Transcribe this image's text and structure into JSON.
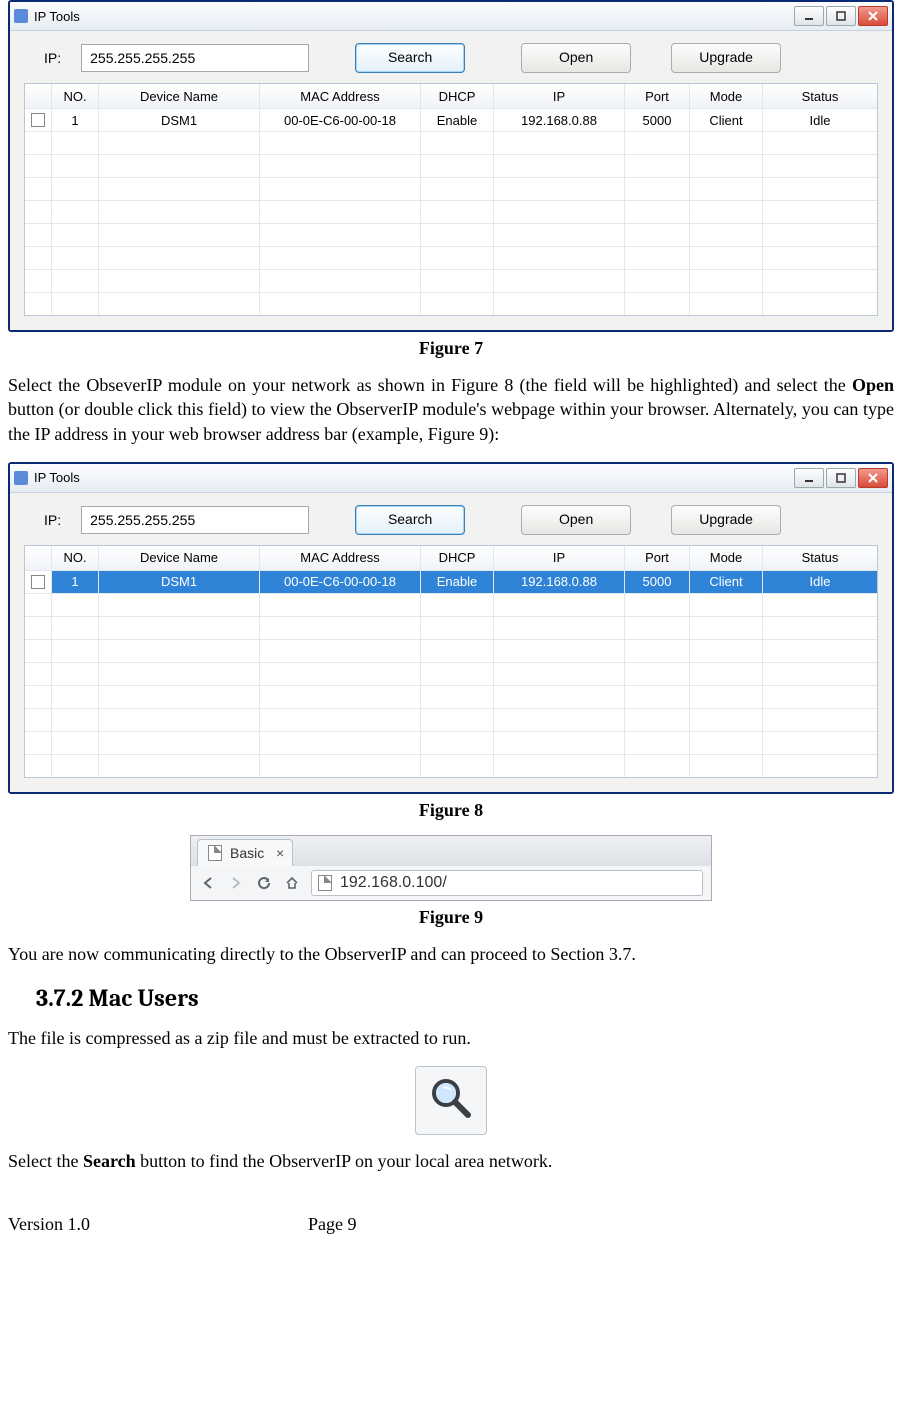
{
  "iptool": {
    "title": "IP Tools",
    "ip_label": "IP:",
    "ip_value": "255.255.255.255",
    "buttons": {
      "search": "Search",
      "open": "Open",
      "upgrade": "Upgrade"
    },
    "columns": {
      "no": "NO.",
      "name": "Device Name",
      "mac": "MAC Address",
      "dhcp": "DHCP",
      "ip": "IP",
      "port": "Port",
      "mode": "Mode",
      "status": "Status"
    },
    "row": {
      "no": "1",
      "name": "DSM1",
      "mac": "00-0E-C6-00-00-18",
      "dhcp": "Enable",
      "ip": "192.168.0.88",
      "port": "5000",
      "mode": "Client",
      "status": "Idle"
    }
  },
  "captions": {
    "fig7": "Figure 7",
    "fig8": "Figure 8",
    "fig9": "Figure 9"
  },
  "paras": {
    "p1a": "Select the ObseverIP module on your network as shown in Figure 8   (the field will be highlighted) and select the ",
    "p1b": "Open",
    "p1c": " button (or double click this field) to view the ObserverIP module's webpage within your browser. Alternately, you can type the IP address in your web browser address bar (example, Figure 9):",
    "p2": "You are now communicating directly to the ObserverIP and can proceed to Section 3.7.",
    "p3": "The file is compressed as a zip file and must be extracted to run.",
    "p4a": "Select the ",
    "p4b": "Search",
    "p4c": " button to find the ObserverIP on your local area network."
  },
  "heading": "3.7.2  Mac Users",
  "browser": {
    "tab": "Basic",
    "url": "192.168.0.100/"
  },
  "footer": {
    "version": "Version 1.0",
    "page": "Page 9"
  }
}
